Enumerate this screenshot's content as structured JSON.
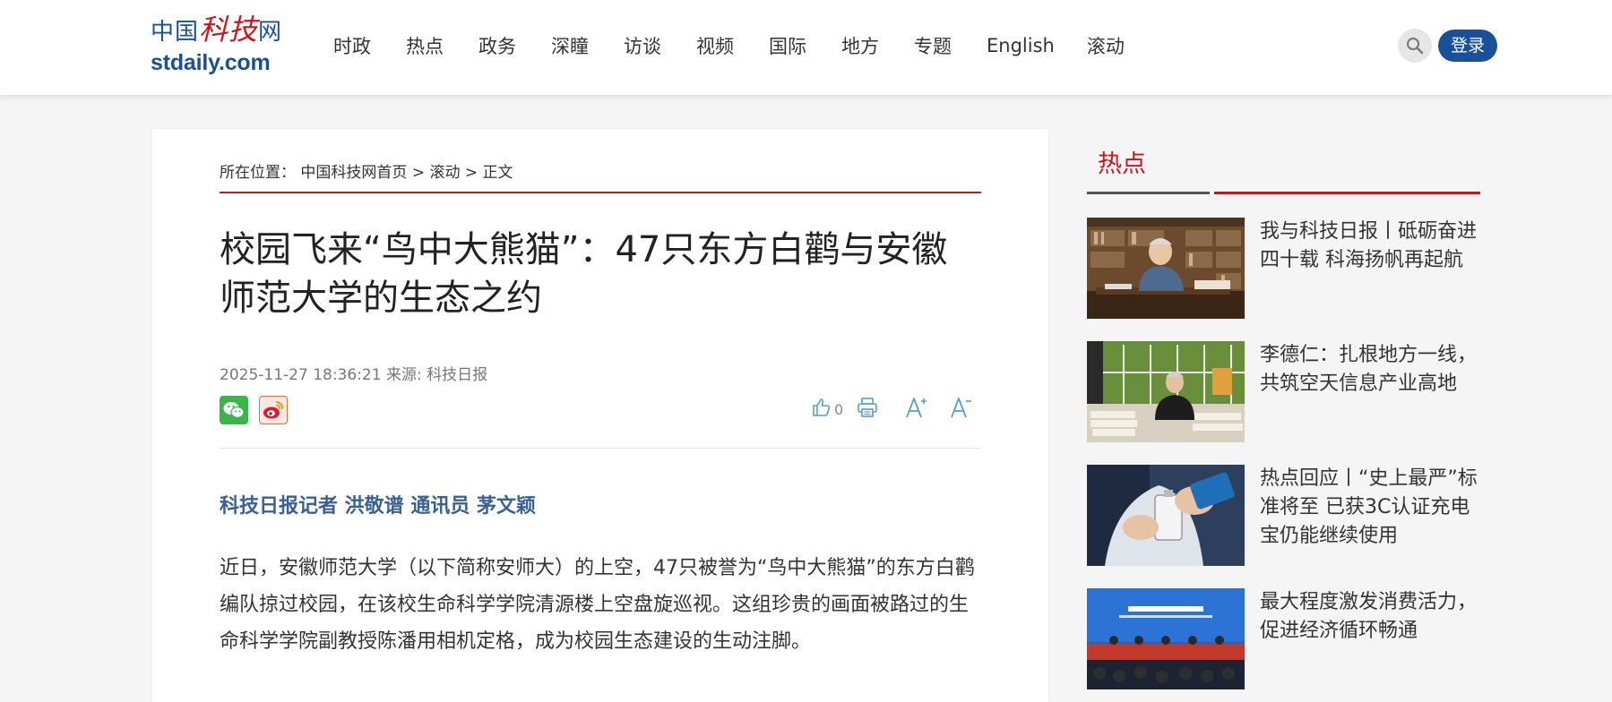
{
  "site": {
    "logo_cn_pre": "中国",
    "logo_cn_red": "科技",
    "logo_cn_post": "网",
    "logo_en": "stdaily.com"
  },
  "nav": {
    "items": [
      "时政",
      "热点",
      "政务",
      "深瞳",
      "访谈",
      "视频",
      "国际",
      "地方",
      "专题",
      "English",
      "滚动"
    ]
  },
  "header": {
    "login_label": "登录"
  },
  "breadcrumb": {
    "prefix": "所在位置：",
    "home": "中国科技网首页",
    "sep1": ">",
    "section": "滚动",
    "sep2": ">",
    "current": "正文"
  },
  "article": {
    "title": "校园飞来“鸟中大熊猫”：47只东方白鹳与安徽师范大学的生态之约",
    "date": "2025-11-27 18:36:21",
    "source_label": "来源:",
    "source": "科技日报",
    "like_count": "0",
    "author": "科技日报记者 洪敬谱 通讯员 茅文颖",
    "paragraph1": "近日，安徽师范大学（以下简称安师大）的上空，47只被誉为“鸟中大熊猫”的东方白鹳编队掠过校园，在该校生命科学学院清源楼上空盘旋巡视。这组珍贵的画面被路过的生命科学学院副教授陈潘用相机定格，成为校园生态建设的生动注脚。"
  },
  "sidebar": {
    "tab_label": "热点",
    "items": [
      {
        "title": "我与科技日报丨砥砺奋进四十载 科海扬帆再起航"
      },
      {
        "title": "李德仁：扎根地方一线，共筑空天信息产业高地"
      },
      {
        "title": "热点回应丨“史上最严”标准将至 已获3C认证充电宝仍能继续使用"
      },
      {
        "title": "最大程度激发消费活力，促进经济循环畅通"
      }
    ]
  },
  "colors": {
    "brand_blue": "#1a4f99",
    "brand_red": "#c8161d",
    "author_blue": "#3a6195",
    "tool_blue": "#5b9bd5"
  }
}
